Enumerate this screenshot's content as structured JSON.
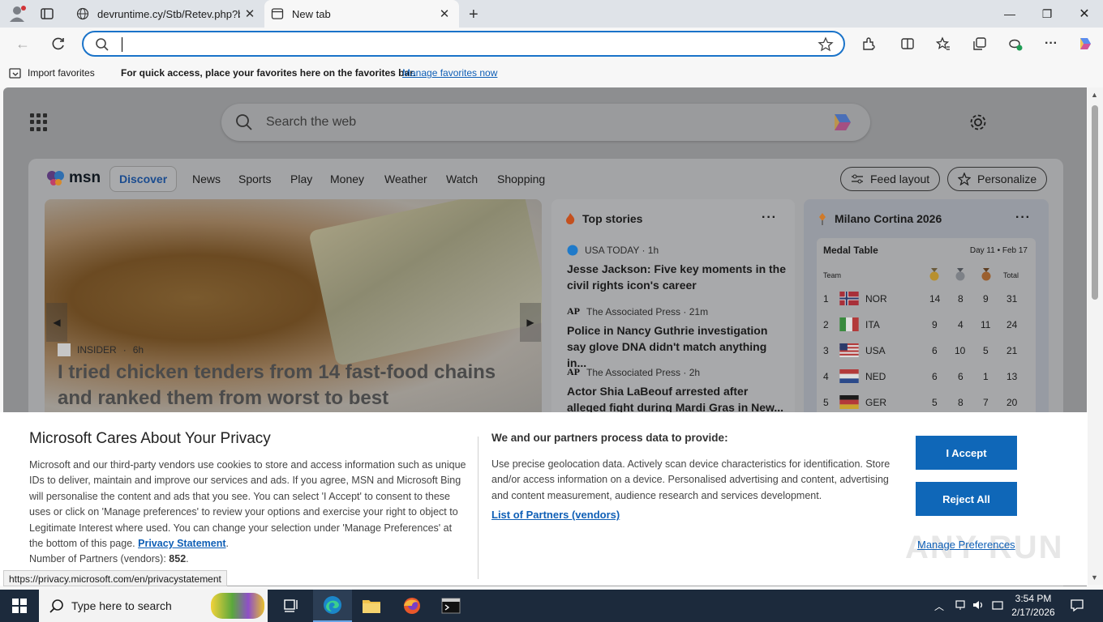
{
  "browser": {
    "tabs": [
      {
        "label": "devruntime.cy/Stb/Retev.php?bl=",
        "active": false
      },
      {
        "label": "New tab",
        "active": true
      }
    ],
    "omnibox": {
      "value": "",
      "placeholder": ""
    },
    "favorites_bar": {
      "import_label": "Import favorites",
      "message": "For quick access, place your favorites here on the favorites bar.",
      "manage_link": "Manage favorites now"
    }
  },
  "newtab": {
    "search_placeholder": "Search the web",
    "msn": {
      "logo_text": "msn",
      "nav": [
        "Discover",
        "News",
        "Sports",
        "Play",
        "Money",
        "Weather",
        "Watch",
        "Shopping"
      ],
      "feed_layout": "Feed layout",
      "personalize": "Personalize"
    },
    "hero": {
      "source": "INSIDER",
      "age": "6h",
      "title": "I tried chicken tenders from 14 fast-food chains and ranked them from worst to best"
    },
    "top_stories": {
      "title": "Top stories",
      "items": [
        {
          "source": "USA TODAY · 1h",
          "headline": "Jesse Jackson: Five key moments in the civil rights icon's career"
        },
        {
          "source": "The Associated Press · 21m",
          "headline": "Police in Nancy Guthrie investigation say glove DNA didn't match anything in..."
        },
        {
          "source": "The Associated Press · 2h",
          "headline": "Actor Shia LaBeouf arrested after alleged fight during Mardi Gras in New..."
        }
      ]
    },
    "olympics": {
      "title": "Milano Cortina 2026",
      "table_title": "Medal Table",
      "day": "Day 11 • Feb 17",
      "headers": {
        "team": "Team",
        "total": "Total"
      },
      "rows": [
        {
          "rank": "1",
          "team": "NOR",
          "gold": "14",
          "silver": "8",
          "bronze": "9",
          "total": "31"
        },
        {
          "rank": "2",
          "team": "ITA",
          "gold": "9",
          "silver": "4",
          "bronze": "11",
          "total": "24"
        },
        {
          "rank": "3",
          "team": "USA",
          "gold": "6",
          "silver": "10",
          "bronze": "5",
          "total": "21"
        },
        {
          "rank": "4",
          "team": "NED",
          "gold": "6",
          "silver": "6",
          "bronze": "1",
          "total": "13"
        },
        {
          "rank": "5",
          "team": "GER",
          "gold": "5",
          "silver": "8",
          "bronze": "7",
          "total": "20"
        }
      ]
    }
  },
  "privacy": {
    "title": "Microsoft Cares About Your Privacy",
    "body": "Microsoft and our third-party vendors use cookies to store and access information such as unique IDs to deliver, maintain and improve our services and ads. If you agree, MSN and Microsoft Bing will personalise the content and ads that you see. You can select 'I Accept' to consent to these uses or click on 'Manage preferences' to review your options and exercise your right to object to Legitimate Interest where used.  You can change your selection under 'Manage Preferences' at the bottom of this page.",
    "statement_link": "Privacy Statement",
    "partners_count_label": "Number of Partners (vendors):",
    "partners_count": "852",
    "purposes_title": "We and our partners process data to provide:",
    "purposes_body": "Use precise geolocation data. Actively scan device characteristics for identification. Store and/or access information on a device. Personalised advertising and content, advertising and content measurement, audience research and services development.",
    "partners_link": "List of Partners (vendors)",
    "accept": "I Accept",
    "reject": "Reject All",
    "manage": "Manage Preferences"
  },
  "status_url": "https://privacy.microsoft.com/en/privacystatement",
  "watermark": "ANY RUN",
  "taskbar": {
    "search_label": "Type here to search",
    "time": "3:54 PM",
    "date": "2/17/2026"
  },
  "colors": {
    "accent": "#0f67b8",
    "omnibox_border": "#1a73c9",
    "taskbar": "#1c2a3c"
  }
}
